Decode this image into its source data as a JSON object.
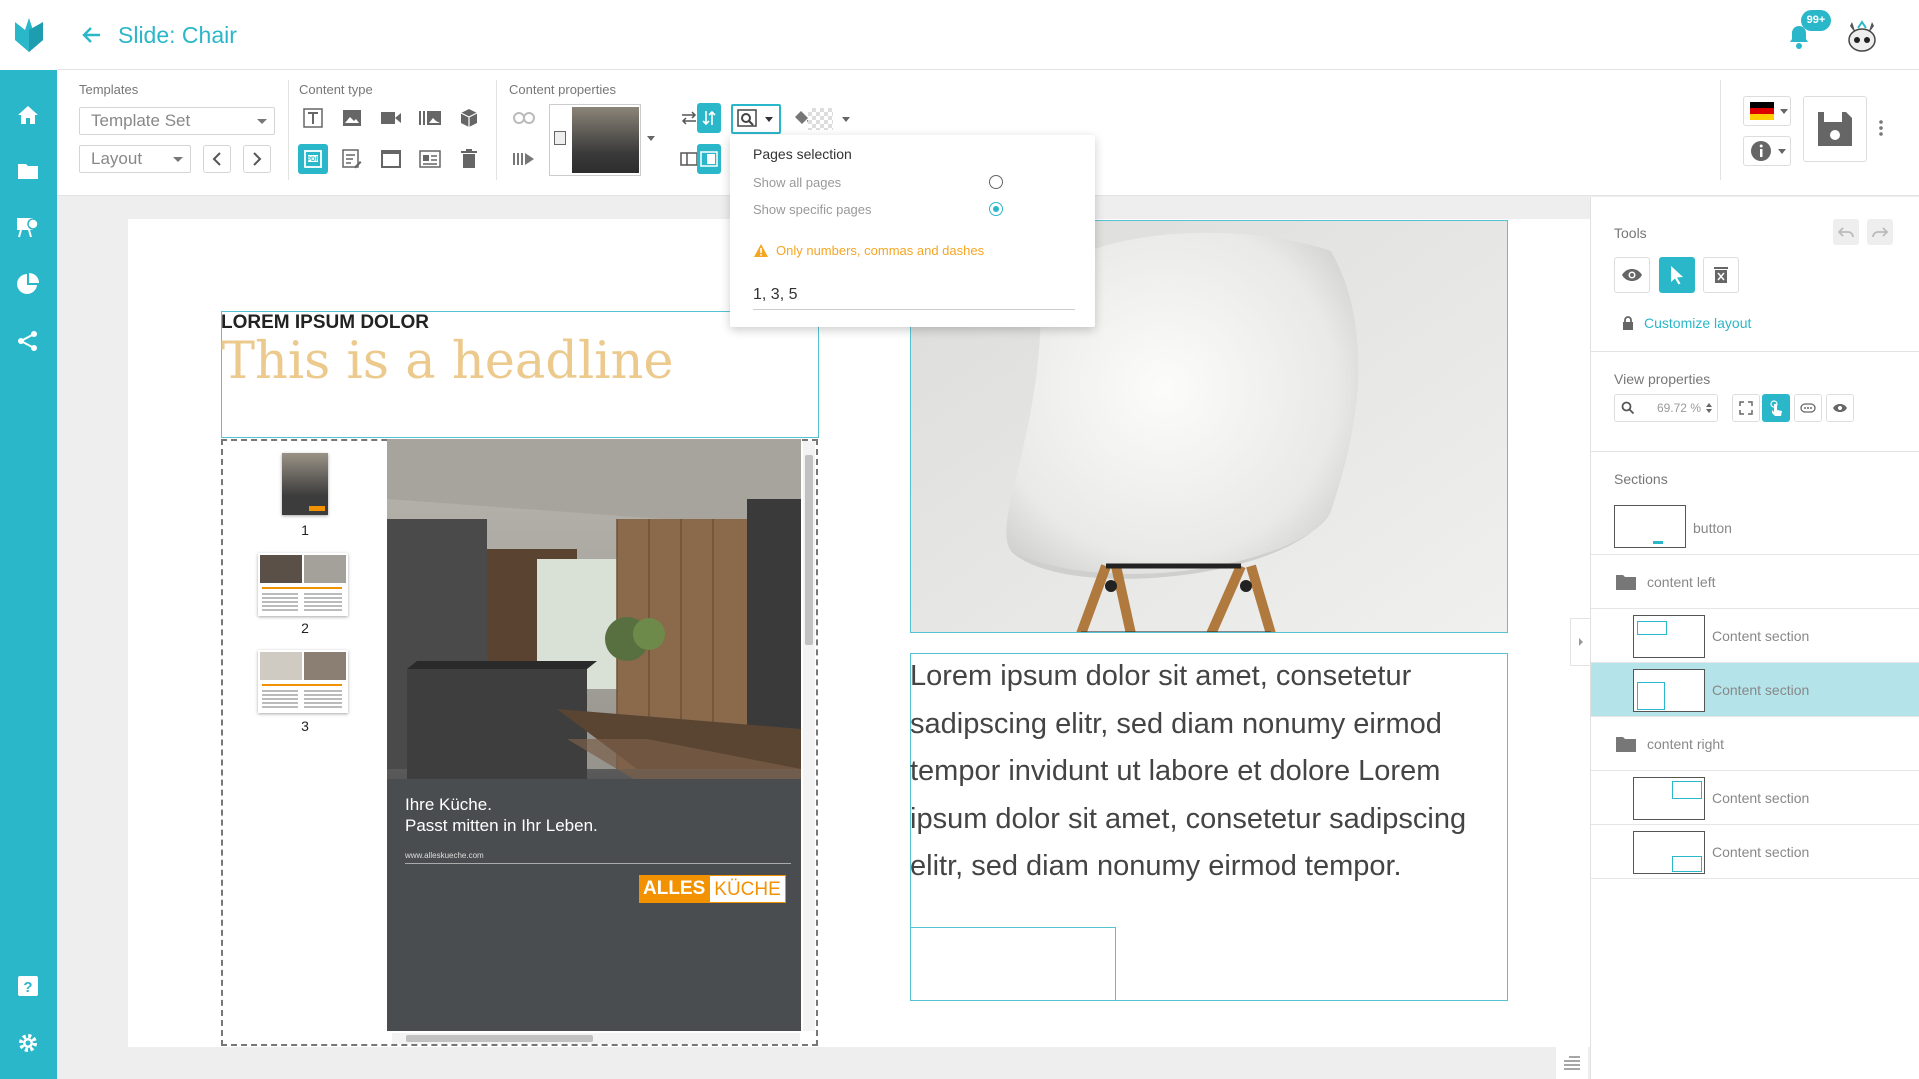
{
  "header": {
    "title": "Slide: Chair",
    "notification_badge": "99+"
  },
  "sidebar": {
    "items": [
      "home-icon",
      "folder-icon",
      "presentation-icon",
      "chart-icon",
      "share-icon",
      "help-icon",
      "settings-icon"
    ]
  },
  "toolbar": {
    "templates_label": "Templates",
    "template_set": "Template Set",
    "layout": "Layout",
    "content_type_label": "Content type",
    "content_properties_label": "Content properties"
  },
  "pages_popup": {
    "title": "Pages selection",
    "option_all": "Show all pages",
    "option_specific": "Show specific pages",
    "selected": "specific",
    "warning": "Only numbers, commas and dashes",
    "value": "1, 3, 5"
  },
  "slide": {
    "kicker": "LOREM IPSUM DOLOR",
    "headline": "This is a headline",
    "thumbnails": [
      "1",
      "2",
      "3"
    ],
    "pdf_tagline_1": "Ihre Küche.",
    "pdf_tagline_2": "Passt mitten in Ihr Leben.",
    "pdf_url": "www.alleskueche.com",
    "pdf_brand_a": "ALLES",
    "pdf_brand_b": "KÜCHE",
    "body_text": "Lorem ipsum dolor sit amet, consetetur sadipscing elitr, sed diam nonumy eirmod tempor invidunt ut labore et dolore Lorem ipsum dolor sit amet, consetetur sadipscing elitr, sed diam nonumy eirmod tempor."
  },
  "right_panel": {
    "tools_label": "Tools",
    "customize_layout": "Customize layout",
    "view_properties_label": "View properties",
    "zoom_value": "69.72 %",
    "sections_label": "Sections",
    "sections": [
      {
        "label": "button",
        "kind": "item"
      },
      {
        "label": "content left",
        "kind": "folder"
      },
      {
        "label": "Content section",
        "kind": "item"
      },
      {
        "label": "Content section",
        "kind": "item",
        "selected": true
      },
      {
        "label": "content right",
        "kind": "folder"
      },
      {
        "label": "Content section",
        "kind": "item"
      },
      {
        "label": "Content section",
        "kind": "item"
      }
    ]
  },
  "colors": {
    "accent": "#2ab7c9",
    "headline": "#ecc98c",
    "warning": "#f5a623",
    "brand_orange": "#f39200"
  }
}
